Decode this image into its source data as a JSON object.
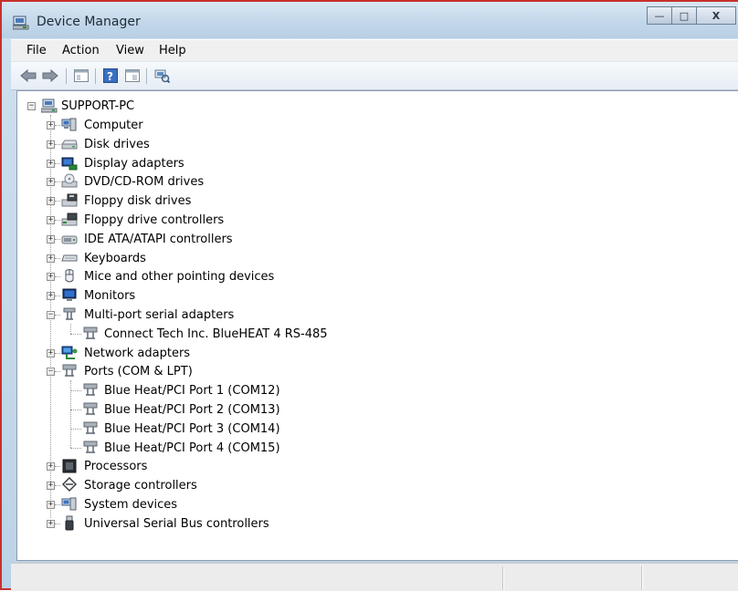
{
  "window": {
    "title": "Device Manager",
    "min_glyph": "—",
    "max_glyph": "□",
    "close_glyph": "X"
  },
  "menu": [
    "File",
    "Action",
    "View",
    "Help"
  ],
  "toolbar": [
    "back-arrow-icon",
    "forward-arrow-icon",
    "show-hide-tree-icon",
    "help-icon",
    "properties-icon",
    "scan-hardware-icon"
  ],
  "tree": {
    "root": "SUPPORT-PC",
    "categories": [
      {
        "label": "Computer",
        "icon": "computer-icon",
        "expanded": false
      },
      {
        "label": "Disk drives",
        "icon": "disk-drive-icon",
        "expanded": false
      },
      {
        "label": "Display adapters",
        "icon": "display-adapter-icon",
        "expanded": false
      },
      {
        "label": "DVD/CD-ROM drives",
        "icon": "dvd-drive-icon",
        "expanded": false
      },
      {
        "label": "Floppy disk drives",
        "icon": "floppy-drive-icon",
        "expanded": false
      },
      {
        "label": "Floppy drive controllers",
        "icon": "floppy-controller-icon",
        "expanded": false
      },
      {
        "label": "IDE ATA/ATAPI controllers",
        "icon": "ide-controller-icon",
        "expanded": false
      },
      {
        "label": "Keyboards",
        "icon": "keyboard-icon",
        "expanded": false
      },
      {
        "label": "Mice and other pointing devices",
        "icon": "mouse-icon",
        "expanded": false
      },
      {
        "label": "Monitors",
        "icon": "monitor-icon",
        "expanded": false
      },
      {
        "label": "Multi-port serial adapters",
        "icon": "serial-adapter-icon",
        "expanded": true,
        "children": [
          "Connect Tech Inc. BlueHEAT 4 RS-485"
        ]
      },
      {
        "label": "Network adapters",
        "icon": "network-adapter-icon",
        "expanded": false
      },
      {
        "label": "Ports (COM & LPT)",
        "icon": "port-icon",
        "expanded": true,
        "children": [
          "Blue Heat/PCI Port 1 (COM12)",
          "Blue Heat/PCI Port 2 (COM13)",
          "Blue Heat/PCI Port 3 (COM14)",
          "Blue Heat/PCI Port 4 (COM15)"
        ]
      },
      {
        "label": "Processors",
        "icon": "processor-icon",
        "expanded": false
      },
      {
        "label": "Storage controllers",
        "icon": "storage-controller-icon",
        "expanded": false
      },
      {
        "label": "System devices",
        "icon": "system-devices-icon",
        "expanded": false
      },
      {
        "label": "Universal Serial Bus controllers",
        "icon": "usb-icon",
        "expanded": false
      }
    ]
  }
}
